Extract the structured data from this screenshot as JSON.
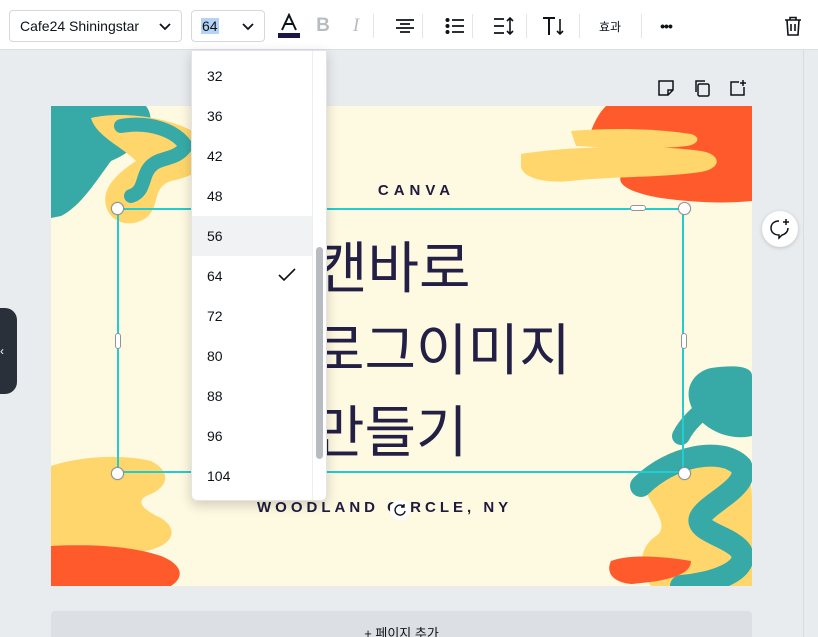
{
  "toolbar": {
    "font_family": "Cafe24 Shiningstar",
    "font_size": "64",
    "bold_label": "B",
    "italic_label": "I",
    "effects_label": "효과",
    "more_label": "•••"
  },
  "size_dropdown": {
    "items": [
      "32",
      "36",
      "42",
      "48",
      "56",
      "64",
      "72",
      "80",
      "88",
      "96",
      "104"
    ],
    "selected": "64",
    "hovered": "56"
  },
  "canvas": {
    "brand": "CANVA",
    "title_lines": [
      "캔바로",
      "로그이미지",
      "만들기"
    ],
    "address": "WOODLAND CIRCLE, NY"
  },
  "add_page_label": "+ 페이지 추가",
  "colors": {
    "teal": "#37aaa8",
    "orange": "#ff5a2b",
    "yellow": "#ffd66b",
    "canvas_bg": "#fef9e1",
    "text_navy": "#241f45",
    "selection": "#22cdd0"
  },
  "collapse_label": "‹"
}
